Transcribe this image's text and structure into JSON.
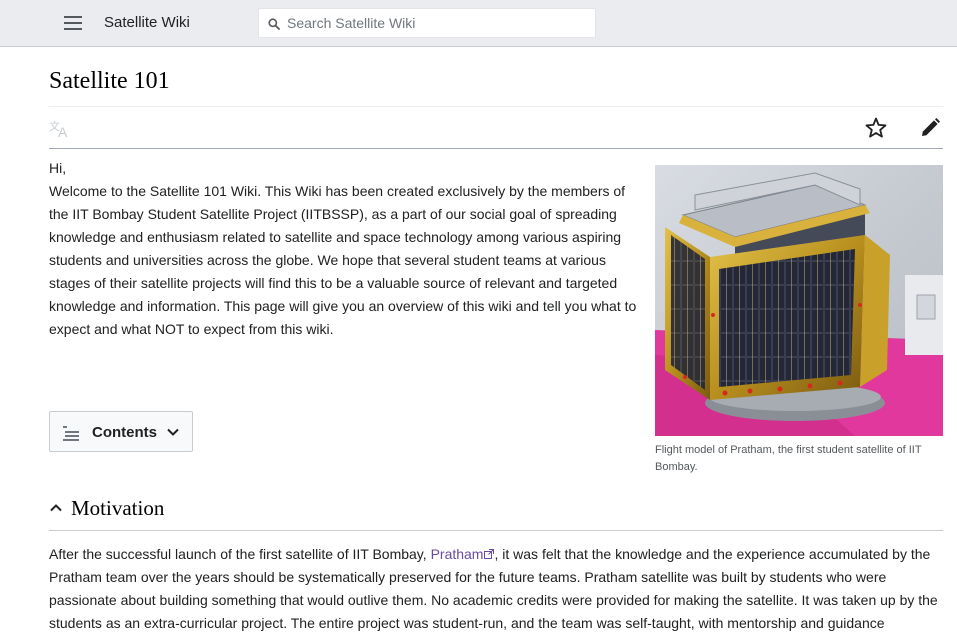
{
  "header": {
    "site_title": "Satellite Wiki",
    "search_placeholder": "Search Satellite Wiki"
  },
  "page": {
    "title": "Satellite 101"
  },
  "intro": {
    "greeting": "Hi,",
    "text": "Welcome to the Satellite 101 Wiki. This Wiki has been created exclusively by the members of the IIT Bombay Student Satellite Project (IITBSSP), as a part of our social goal of spreading knowledge and enthusiasm related to satellite and space technology among various aspiring students and universities across the globe. We hope that several student teams at various stages of their satellite projects will find this to be a valuable source of relevant and targeted knowledge and information. This page will give you an overview of this wiki and tell you what to expect and what NOT to expect from this wiki."
  },
  "figure": {
    "caption": "Flight model of Pratham, the first student satellite of IIT Bombay."
  },
  "toc": {
    "label": "Contents"
  },
  "section": {
    "title": "Motivation",
    "para_before_link": "After the successful launch of the first satellite of IIT Bombay, ",
    "link_text": "Pratham",
    "para_after_link": ", it was felt that the knowledge and the experience accumulated by the Pratham team over the years should be systematically preserved for the future teams. Pratham satellite was built by students who were passionate about building something that would outlive them. No academic credits were provided for making the satellite. It was taken up by the students as an extra-curricular project. The entire project was student-run, and the team was self-taught, with mentorship and guidance"
  },
  "colors": {
    "header_bg": "#eaecf0",
    "link": "#6b4ba1",
    "text": "#202122",
    "caption": "#54595d"
  },
  "icons": [
    "menu-icon",
    "search-icon",
    "language-icon",
    "star-icon",
    "edit-pencil-icon",
    "contents-list-icon",
    "chevron-down-icon",
    "chevron-up-icon",
    "external-link-icon"
  ]
}
